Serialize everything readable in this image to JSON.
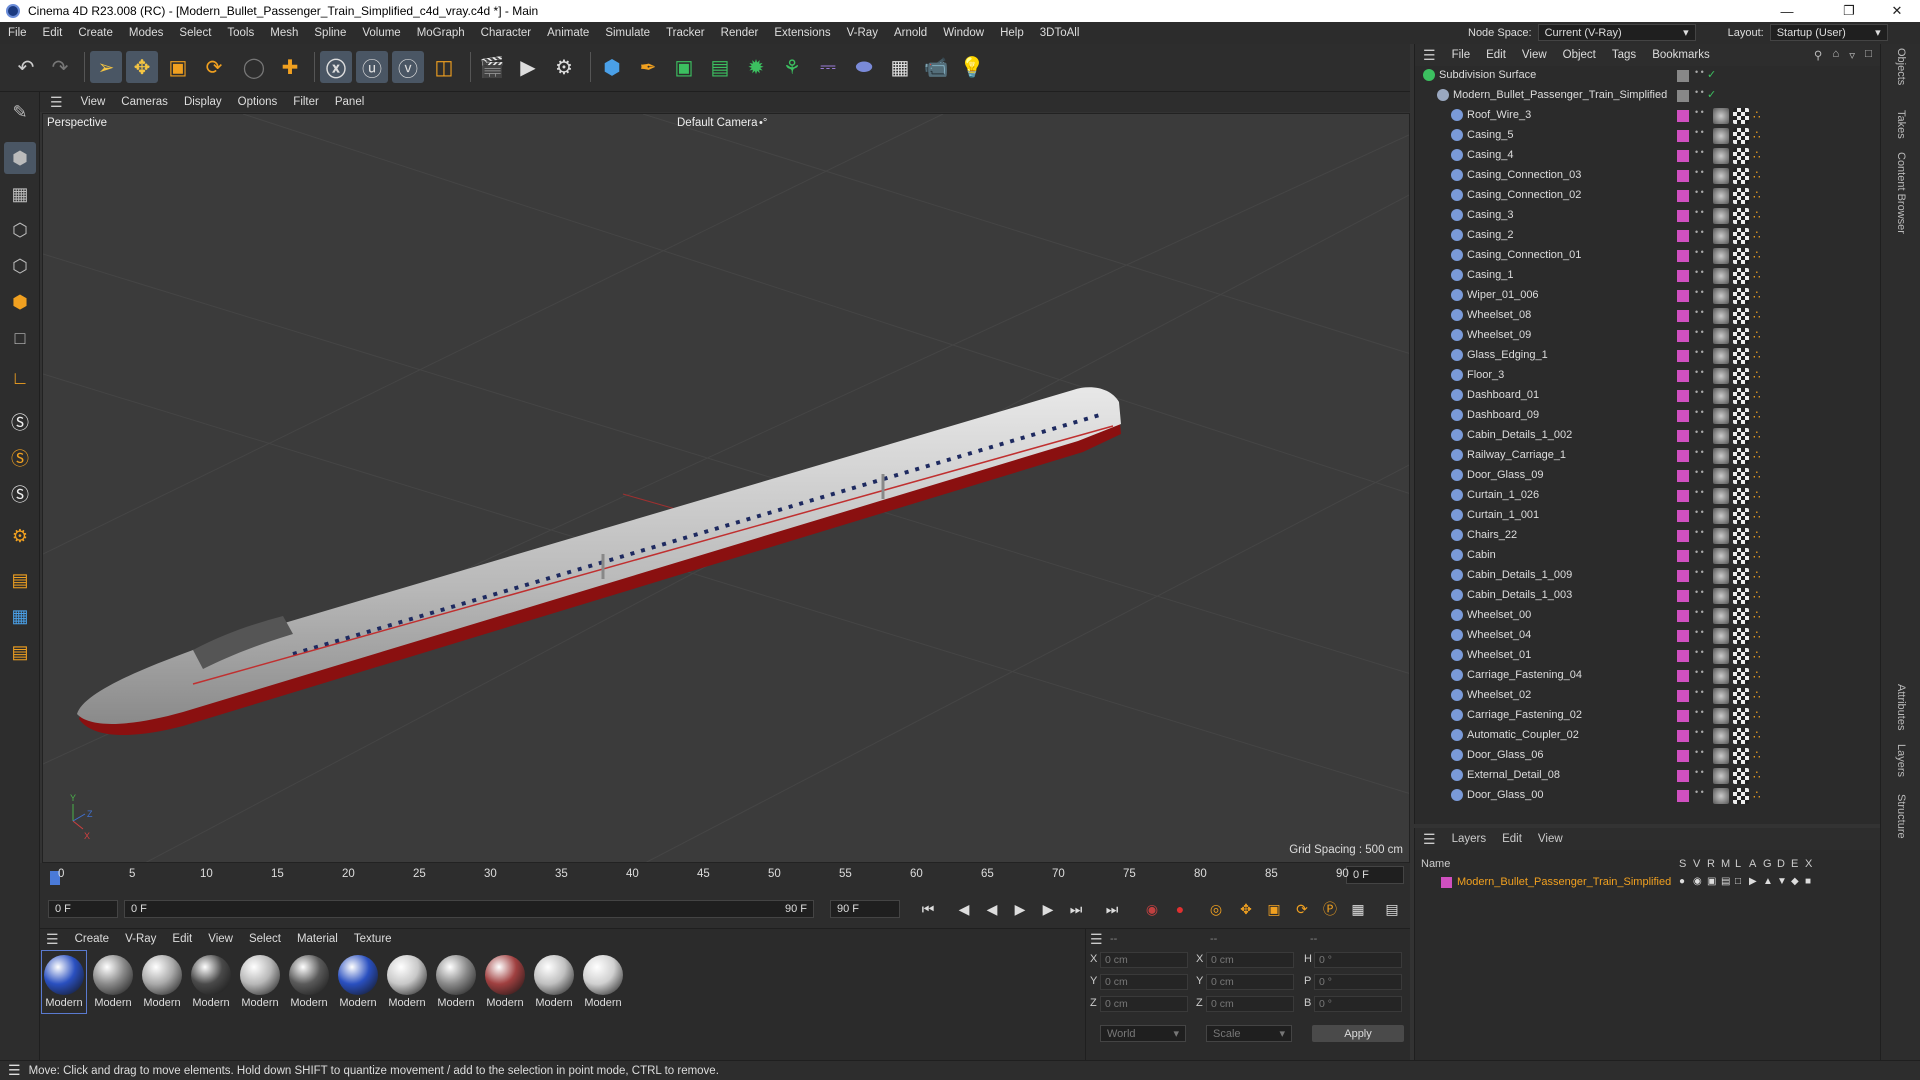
{
  "window": {
    "title": "Cinema 4D R23.008 (RC) - [Modern_Bullet_Passenger_Train_Simplified_c4d_vray.c4d *] - Main"
  },
  "menubar": {
    "items": [
      "File",
      "Edit",
      "Create",
      "Modes",
      "Select",
      "Tools",
      "Mesh",
      "Spline",
      "Volume",
      "MoGraph",
      "Character",
      "Animate",
      "Simulate",
      "Tracker",
      "Render",
      "Extensions",
      "V-Ray",
      "Arnold",
      "Window",
      "Help",
      "3DToAll"
    ],
    "node_space_label": "Node Space:",
    "node_space_value": "Current (V-Ray)",
    "layout_label": "Layout:",
    "layout_value": "Startup (User)"
  },
  "viewport": {
    "menu": [
      "View",
      "Cameras",
      "Display",
      "Options",
      "Filter",
      "Panel"
    ],
    "label": "Perspective",
    "camera": "Default Camera",
    "grid_spacing": "Grid Spacing : 500 cm"
  },
  "timeline": {
    "ticks": [
      "0",
      "5",
      "10",
      "15",
      "20",
      "25",
      "30",
      "35",
      "40",
      "45",
      "50",
      "55",
      "60",
      "65",
      "70",
      "75",
      "80",
      "85",
      "90"
    ],
    "end_field": "0 F"
  },
  "transport": {
    "start": "0 F",
    "range_start": "0 F",
    "range_end": "90 F",
    "end": "90 F"
  },
  "materials": {
    "menu": [
      "Create",
      "V-Ray",
      "Edit",
      "View",
      "Select",
      "Material",
      "Texture"
    ],
    "label": "Modern",
    "count": 12
  },
  "coords": {
    "dashes": [
      "--",
      "--",
      "--"
    ],
    "rows": [
      {
        "a": "X",
        "av": "0 cm",
        "b": "X",
        "bv": "0 cm",
        "c": "H",
        "cv": "0 °"
      },
      {
        "a": "Y",
        "av": "0 cm",
        "b": "Y",
        "bv": "0 cm",
        "c": "P",
        "cv": "0 °"
      },
      {
        "a": "Z",
        "av": "0 cm",
        "b": "Z",
        "bv": "0 cm",
        "c": "B",
        "cv": "0 °"
      }
    ],
    "world": "World",
    "scale": "Scale",
    "apply": "Apply"
  },
  "objects": {
    "menu": [
      "File",
      "Edit",
      "View",
      "Object",
      "Tags",
      "Bookmarks"
    ],
    "root": "Subdivision Surface",
    "group": "Modern_Bullet_Passenger_Train_Simplified",
    "items": [
      "Roof_Wire_3",
      "Casing_5",
      "Casing_4",
      "Casing_Connection_03",
      "Casing_Connection_02",
      "Casing_3",
      "Casing_2",
      "Casing_Connection_01",
      "Casing_1",
      "Wiper_01_006",
      "Wheelset_08",
      "Wheelset_09",
      "Glass_Edging_1",
      "Floor_3",
      "Dashboard_01",
      "Dashboard_09",
      "Cabin_Details_1_002",
      "Railway_Carriage_1",
      "Door_Glass_09",
      "Curtain_1_026",
      "Curtain_1_001",
      "Chairs_22",
      "Cabin",
      "Cabin_Details_1_009",
      "Cabin_Details_1_003",
      "Wheelset_00",
      "Wheelset_04",
      "Wheelset_01",
      "Carriage_Fastening_04",
      "Wheelset_02",
      "Carriage_Fastening_02",
      "Automatic_Coupler_02",
      "Door_Glass_06",
      "External_Detail_08",
      "Door_Glass_00"
    ]
  },
  "layers": {
    "menu": [
      "Layers",
      "Edit",
      "View"
    ],
    "name_header": "Name",
    "cols": [
      "S",
      "V",
      "R",
      "M",
      "L",
      "A",
      "G",
      "D",
      "E",
      "X"
    ],
    "layer": "Modern_Bullet_Passenger_Train_Simplified"
  },
  "right_tabs": [
    "Objects",
    "Takes",
    "Content Browser",
    "Attributes",
    "Layers",
    "Structure"
  ],
  "status": "Move: Click and drag to move elements. Hold down SHIFT to quantize movement / add to the selection in point mode, CTRL to remove."
}
